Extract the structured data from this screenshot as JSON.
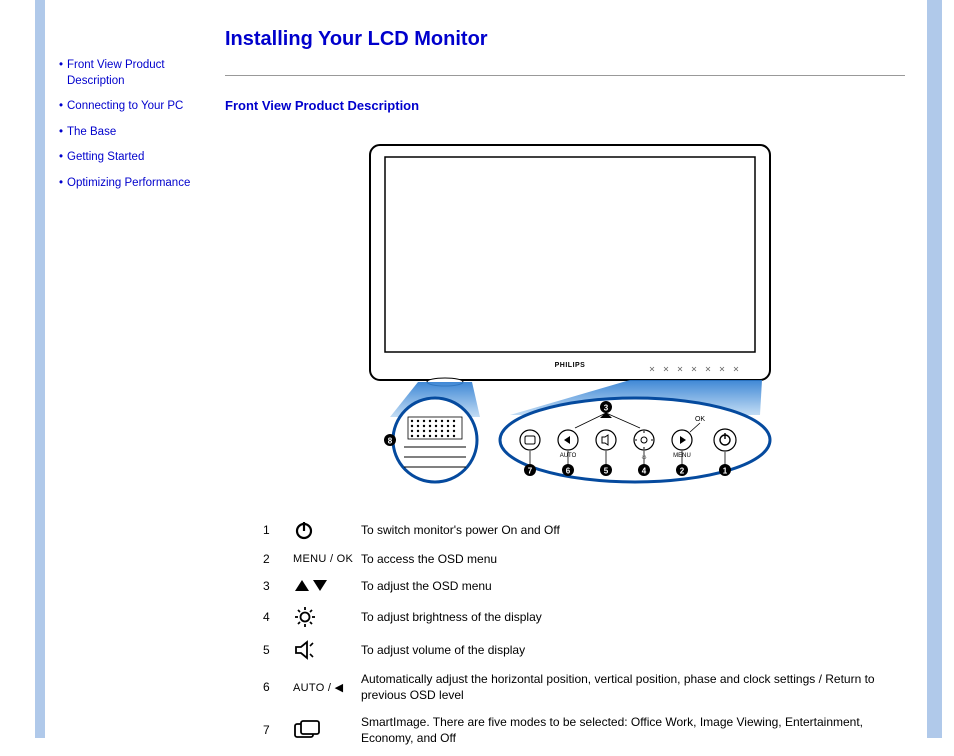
{
  "sidebar": {
    "items": [
      {
        "label": "Front View Product Description"
      },
      {
        "label": "Connecting to Your PC"
      },
      {
        "label": "The Base"
      },
      {
        "label": "Getting Started"
      },
      {
        "label": "Optimizing Performance"
      }
    ]
  },
  "page": {
    "title": "Installing Your LCD Monitor",
    "section_heading": "Front View Product Description"
  },
  "diagram": {
    "brand_label": "PHILIPS",
    "callouts": [
      "1",
      "2",
      "3",
      "4",
      "5",
      "6",
      "7",
      "8"
    ],
    "button_labels": {
      "auto": "AUTO",
      "menu": "MENU",
      "ok": "OK"
    }
  },
  "legend": {
    "rows": [
      {
        "num": "1",
        "symbol_name": "power-icon",
        "symbol_text": "",
        "desc": "To switch monitor's power On and Off"
      },
      {
        "num": "2",
        "symbol_name": "menu-ok-label",
        "symbol_text": "MENU / OK",
        "desc": "To access the OSD menu"
      },
      {
        "num": "3",
        "symbol_name": "up-down-icon",
        "symbol_text": "",
        "desc": "To adjust the OSD menu"
      },
      {
        "num": "4",
        "symbol_name": "brightness-icon",
        "symbol_text": "",
        "desc": "To adjust brightness of the display"
      },
      {
        "num": "5",
        "symbol_name": "volume-icon",
        "symbol_text": "",
        "desc": "To adjust volume of the display"
      },
      {
        "num": "6",
        "symbol_name": "auto-back-label",
        "symbol_text": "AUTO / ◀",
        "desc": "Automatically adjust the horizontal position, vertical position, phase and clock settings / Return to previous OSD level"
      },
      {
        "num": "7",
        "symbol_name": "smartimage-icon",
        "symbol_text": "",
        "desc": "SmartImage. There are five modes to be selected: Office Work, Image Viewing, Entertainment, Economy, and Off"
      }
    ]
  }
}
